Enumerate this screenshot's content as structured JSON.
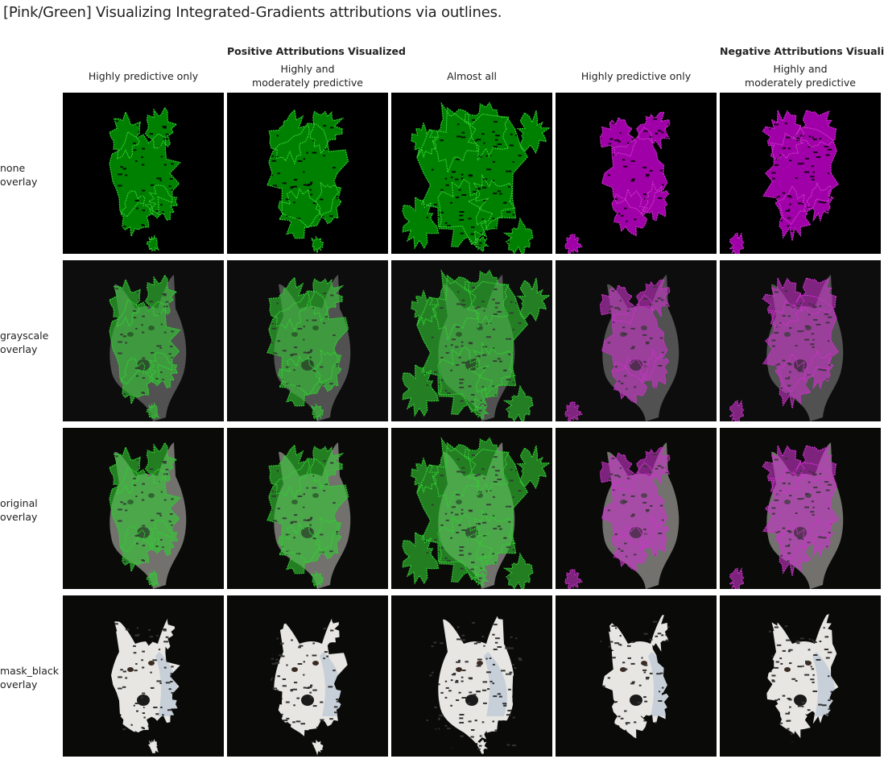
{
  "title": "[Pink/Green] Visualizing Integrated-Gradients attributions via outlines.",
  "groups": [
    {
      "label": "Positive Attributions Visualized",
      "sign": "positive",
      "color": "#00ff00"
    },
    {
      "label": "Negative Attributions Visualized",
      "sign": "negative",
      "color": "#ff00ff"
    }
  ],
  "columns": [
    {
      "label": "Highly predictive only",
      "sign": "positive",
      "level": "high"
    },
    {
      "label": "Highly and moderately predictive",
      "sign": "positive",
      "level": "moderate"
    },
    {
      "label": "Almost all",
      "sign": "positive",
      "level": "all"
    },
    {
      "label": "Highly predictive only",
      "sign": "negative",
      "level": "high"
    },
    {
      "label": "Highly and moderately predictive",
      "sign": "negative",
      "level": "moderate"
    }
  ],
  "rows": [
    {
      "label": "none overlay",
      "line1": "none",
      "line2": "overlay",
      "mode": "none"
    },
    {
      "label": "grayscale overlay",
      "line1": "grayscale",
      "line2": "overlay",
      "mode": "grayscale"
    },
    {
      "label": "original overlay",
      "line1": "original",
      "line2": "overlay",
      "mode": "original"
    },
    {
      "label": "mask_black overlay",
      "line1": "mask_black",
      "line2": "overlay",
      "mode": "mask_black"
    }
  ],
  "colors": {
    "positive_fill": "#008000",
    "positive_outline": "#33cc33",
    "negative_fill": "#a000a8",
    "negative_outline": "#cc33cc",
    "background": "#000000"
  }
}
